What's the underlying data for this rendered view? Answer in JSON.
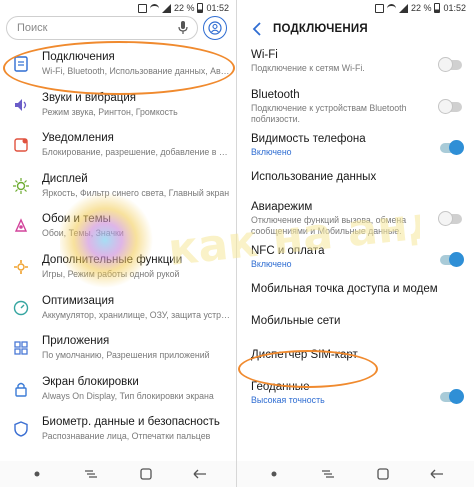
{
  "status_bar": {
    "battery": "22 %",
    "time": "01:52"
  },
  "left_screen": {
    "search_placeholder": "Поиск",
    "items": [
      {
        "title": "Подключения",
        "sub": "Wi-Fi, Bluetooth, Использование данных, Ави...",
        "icon": "connections-icon",
        "color": "#2f6dd2"
      },
      {
        "title": "Звуки и вибрация",
        "sub": "Режим звука, Рингтон, Громкость",
        "icon": "sound-icon",
        "color": "#6a5cc8"
      },
      {
        "title": "Уведомления",
        "sub": "Блокирование, разрешение, добавление в приор...",
        "icon": "notifications-icon",
        "color": "#e0523f"
      },
      {
        "title": "Дисплей",
        "sub": "Яркость, Фильтр синего света, Главный экран",
        "icon": "display-icon",
        "color": "#6cab2f"
      },
      {
        "title": "Обои и темы",
        "sub": "Обои, Темы, Значки",
        "icon": "themes-icon",
        "color": "#d2439b"
      },
      {
        "title": "Дополнительные функции",
        "sub": "Игры, Режим работы одной рукой",
        "icon": "advanced-features-icon",
        "color": "#f0a22e"
      },
      {
        "title": "Оптимизация",
        "sub": "Аккумулятор, хранилище, ОЗУ, защита устро...",
        "icon": "optimization-icon",
        "color": "#35a5a0"
      },
      {
        "title": "Приложения",
        "sub": "По умолчанию, Разрешения приложений",
        "icon": "apps-icon",
        "color": "#4a78d6"
      },
      {
        "title": "Экран блокировки",
        "sub": "Always On Display, Тип блокировки экрана",
        "icon": "lock-screen-icon",
        "color": "#3b7bd6"
      },
      {
        "title": "Биометр. данные и безопасность",
        "sub": "Распознавание лица, Отпечатки пальцев",
        "icon": "biometrics-icon",
        "color": "#3b6fd2"
      }
    ]
  },
  "right_screen": {
    "title": "ПОДКЛЮЧЕНИЯ",
    "items": [
      {
        "title": "Wi-Fi",
        "sub": "Подключение к сетям Wi-Fi.",
        "toggle": "off",
        "sub_on": false
      },
      {
        "title": "Bluetooth",
        "sub": "Подключение к устройствам Bluetooth поблизости.",
        "toggle": "off",
        "sub_on": false
      },
      {
        "title": "Видимость телефона",
        "sub": "Включено",
        "toggle": "on",
        "sub_on": true
      },
      {
        "title": "Использование данных",
        "sub": "",
        "toggle": "none",
        "sub_on": false
      },
      {
        "title": "Авиарежим",
        "sub": "Отключение функций вызова, обмена сообщениями и Мобильные данные.",
        "toggle": "off",
        "sub_on": false
      },
      {
        "title": "NFC и оплата",
        "sub": "Включено",
        "toggle": "on",
        "sub_on": true
      },
      {
        "title": "Мобильная точка доступа и модем",
        "sub": "",
        "toggle": "none",
        "sub_on": false
      },
      {
        "title": "Мобильные сети",
        "sub": "",
        "toggle": "none",
        "sub_on": false
      },
      {
        "title": "Диспетчер SIM-карт",
        "sub": "",
        "toggle": "none",
        "sub_on": false
      },
      {
        "title": "Геоданные",
        "sub": "Высокая точность",
        "toggle": "on",
        "sub_on": true
      }
    ]
  },
  "watermark_text": "как на андроид",
  "colors": {
    "accent": "#2f6dd2",
    "highlight": "#f08a2e",
    "toggle_on": "#2f8fd6"
  }
}
